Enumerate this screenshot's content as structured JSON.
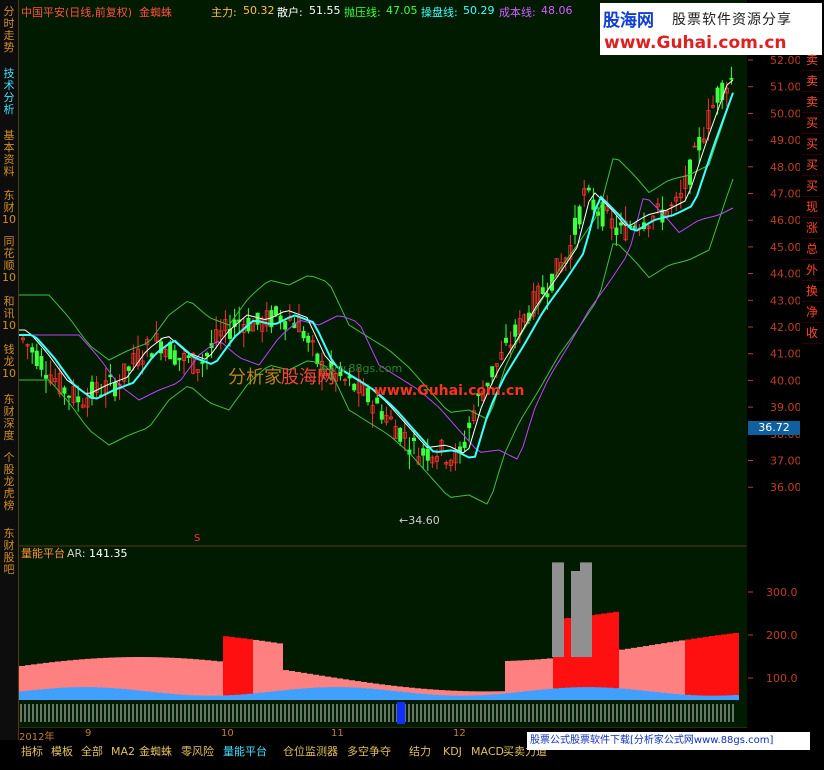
{
  "header": {
    "title": "中国平安(日线,前复权)",
    "indicator": "金蜘蛛",
    "zhuli_label": "主力:",
    "zhuli_value": "50.32",
    "sanhu_label": "散户:",
    "sanhu_value": "51.55",
    "paoya_label": "抛压线:",
    "paoya_value": "47.05",
    "caopan_label": "操盘线:",
    "caopan_value": "50.29",
    "chengben_label": "成本线:",
    "chengben_value": "48.06"
  },
  "left_tabs": [
    "分时走势",
    "技术分析",
    "基本资料",
    "东财10",
    "同花顺10",
    "和讯10",
    "钱龙10",
    "东财深度",
    "个股龙虎榜",
    "东财股吧"
  ],
  "right_tabs": [
    "卖",
    "卖",
    "卖",
    "买",
    "买",
    "买",
    "买",
    "现",
    "涨",
    "总",
    "外",
    "换",
    "净"
  ],
  "right_tabs_extra": "收",
  "logo": {
    "brand": "股海网",
    "slogan": "股票软件资源分享",
    "url": "www.Guhai.com.cn"
  },
  "watermark": {
    "text1": "分析家",
    "text2": "股海网",
    "url1": "www.88gs.com",
    "url2": "www.Guhai.com.cn"
  },
  "price_axis": [
    "52.00",
    "51.00",
    "50.00",
    "49.00",
    "48.00",
    "47.00",
    "46.00",
    "45.00",
    "44.00",
    "43.00",
    "42.00",
    "41.00",
    "40.00",
    "39.00",
    "38.00",
    "37.00",
    "36.00"
  ],
  "current_price": "36.72",
  "low_label": "34.60",
  "panel2": {
    "title": "量能平台",
    "ar_label": "AR:",
    "ar_value": "141.35",
    "axis": [
      "300.0",
      "200.0",
      "100.0"
    ]
  },
  "months": [
    "2012年",
    "9",
    "10",
    "11",
    "12"
  ],
  "bottom_tabs": [
    "指标",
    "模板",
    "全部",
    "MA2",
    "金蜘蛛",
    "零风险",
    "量能平台",
    "仓位监测器",
    "多空争夺",
    "结力",
    "KDJ",
    "MACD",
    "买卖力道"
  ],
  "bottom_notice": "股票公式股票软件下载[分析家公式网www.88gs.com]",
  "colors": {
    "up": "#ff3030",
    "down": "#40ff40",
    "caopan": "#40ffff",
    "zhuli": "#ffffff",
    "chengben": "#c040ff",
    "band": "#40c040"
  }
}
